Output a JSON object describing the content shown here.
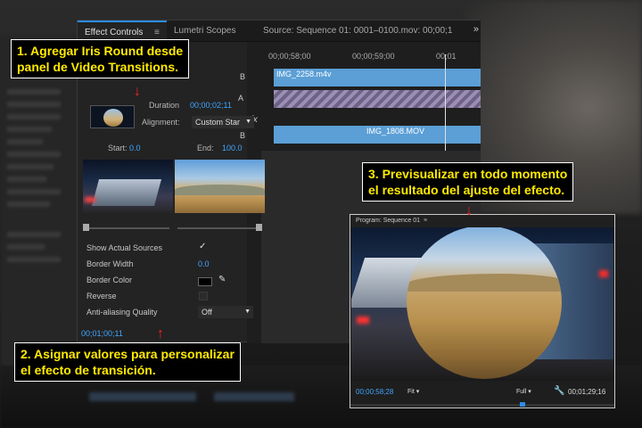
{
  "panel": {
    "tabs": [
      {
        "label": "Effect Controls",
        "menu": "≡"
      },
      {
        "label": "Lumetri Scopes"
      },
      {
        "label": "Source: Sequence 01: 0001–0100.mov: 00;00;1"
      }
    ],
    "overflow": "»"
  },
  "effect_controls": {
    "duration_label": "Duration",
    "duration_value": "00;00;02;11",
    "alignment_label": "Alignment:",
    "alignment_value": "Custom Star",
    "start_label": "Start:",
    "start_value": "0.0",
    "end_label": "End:",
    "end_value": "100.0",
    "show_actual_sources_label": "Show Actual Sources",
    "show_actual_sources_checked": "✓",
    "border_width_label": "Border Width",
    "border_width_value": "0.0",
    "border_color_label": "Border Color",
    "reverse_label": "Reverse",
    "aa_label": "Anti-aliasing Quality",
    "aa_value": "Off",
    "timecode": "00;01;00;11",
    "border_color": "#000000"
  },
  "timeline": {
    "ruler": [
      "00;00;58;00",
      "00;00;59;00",
      "00;01"
    ],
    "track_letters": [
      "B",
      "A",
      "B"
    ],
    "clip1": "IMG_2258.m4v",
    "clip2": "IMG_1808.MOV",
    "fx": "fx"
  },
  "program": {
    "title": "Program: Sequence 01",
    "menu": "≡",
    "timecode_left": "00;00;58;28",
    "fit": "Fit",
    "full": "Full",
    "timecode_right": "00;01;29;16"
  },
  "callouts": {
    "c1": [
      "1. Agregar Iris Round desde",
      "panel de Video Transitions."
    ],
    "c2": [
      "2. Asignar valores para personalizar",
      "el efecto de transición."
    ],
    "c3": [
      "3. Previsualizar en todo momento",
      "el resultado del ajuste del efecto."
    ]
  },
  "colors": {
    "accent": "#2d8ceb",
    "value_blue": "#3fa6ff",
    "callout_text": "#ffea00",
    "arrow": "#ff2020"
  }
}
